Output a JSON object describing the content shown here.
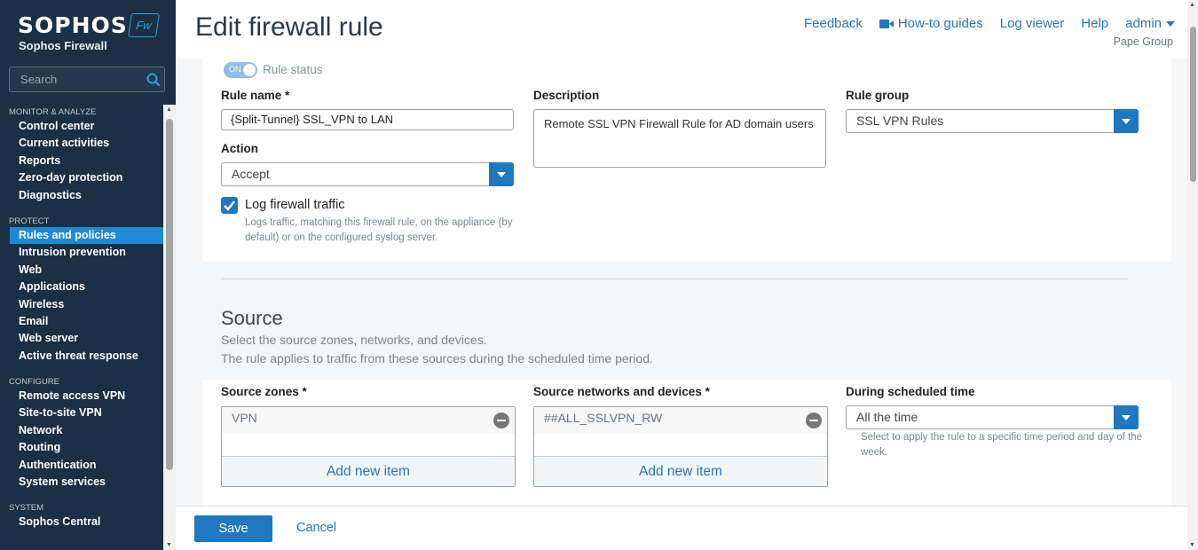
{
  "sidebar": {
    "brand": "SOPHOS",
    "badge": "Fw",
    "product": "Sophos Firewall",
    "search_placeholder": "Search",
    "sections": [
      {
        "title": "MONITOR & ANALYZE",
        "items": [
          "Control center",
          "Current activities",
          "Reports",
          "Zero-day protection",
          "Diagnostics"
        ]
      },
      {
        "title": "PROTECT",
        "items": [
          "Rules and policies",
          "Intrusion prevention",
          "Web",
          "Applications",
          "Wireless",
          "Email",
          "Web server",
          "Active threat response"
        ]
      },
      {
        "title": "CONFIGURE",
        "items": [
          "Remote access VPN",
          "Site-to-site VPN",
          "Network",
          "Routing",
          "Authentication",
          "System services"
        ]
      },
      {
        "title": "SYSTEM",
        "items": [
          "Sophos Central"
        ]
      }
    ],
    "active_item": "Rules and policies"
  },
  "header": {
    "title": "Edit firewall rule",
    "links": {
      "feedback": "Feedback",
      "howto": "How-to guides",
      "logviewer": "Log viewer",
      "help": "Help",
      "admin": "admin"
    },
    "company": "Pape Group"
  },
  "rule": {
    "status_toggle": "ON",
    "status_label": "Rule status",
    "name_label": "Rule name *",
    "name_value": "{Split-Tunnel} SSL_VPN to LAN",
    "desc_label": "Description",
    "desc_value": "Remote SSL VPN Firewall Rule for AD domain users",
    "group_label": "Rule group",
    "group_value": "SSL VPN Rules",
    "action_label": "Action",
    "action_value": "Accept",
    "log_label": "Log firewall traffic",
    "log_checked": true,
    "log_help": "Logs traffic, matching this firewall rule, on the appliance (by default) or on the configured syslog server."
  },
  "source": {
    "title": "Source",
    "desc1": "Select the source zones, networks, and devices.",
    "desc2": "The rule applies to traffic from these sources during the scheduled time period.",
    "zones_label": "Source zones *",
    "zones_value": "VPN",
    "networks_label": "Source networks and devices *",
    "networks_value": "##ALL_SSLVPN_RW",
    "add_item": "Add new item",
    "schedule_label": "During scheduled time",
    "schedule_value": "All the time",
    "schedule_help": "Select to apply the rule to a specific time period and day of the week."
  },
  "footer": {
    "save": "Save",
    "cancel": "Cancel"
  },
  "colors": {
    "sidebar": "#1b2f45",
    "accent": "#1f78c1",
    "active": "#1f8ad4"
  }
}
